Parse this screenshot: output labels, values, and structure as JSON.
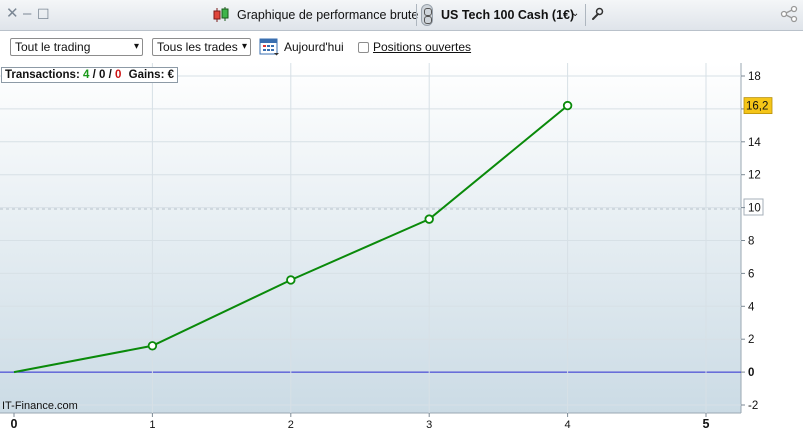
{
  "window": {
    "title": "Graphique de performance brute",
    "instrument": "US Tech 100 Cash (1€)",
    "close_glyph": "✕",
    "minimize_glyph": "–",
    "maximize_glyph": "☐"
  },
  "toolbar": {
    "trading_select": "Tout le trading",
    "trades_select": "Tous les trades",
    "today_label": "Aujourd'hui",
    "open_positions_label": "Positions ouvertes",
    "open_positions_checked": false
  },
  "legend": {
    "transactions_label": "Transactions:",
    "wins": "4",
    "sep1": "/",
    "neutral": "0",
    "sep2": "/",
    "losses": "0",
    "gains_label": "Gains: €"
  },
  "watermark": "IT-Finance.com",
  "colors": {
    "line": "#0a8a0a",
    "zero_line": "#2a2ad0",
    "wins": "#1a9a1a",
    "losses": "#cc1111",
    "last_value_bg": "#f5c518"
  },
  "chart_data": {
    "type": "line",
    "x": [
      0,
      1,
      2,
      3,
      4
    ],
    "series": [
      {
        "values": [
          0,
          1.6,
          5.6,
          9.3,
          16.2
        ]
      }
    ],
    "xlim": [
      0,
      5
    ],
    "ylim": [
      -2,
      18
    ],
    "x_ticks": [
      "0",
      "1",
      "2",
      "3",
      "4",
      "5"
    ],
    "y_ticks": [
      "-2",
      "0",
      "2",
      "4",
      "6",
      "8",
      "10",
      "12",
      "14",
      "16",
      "18"
    ],
    "last_value_label": "16,2",
    "grid": true
  }
}
